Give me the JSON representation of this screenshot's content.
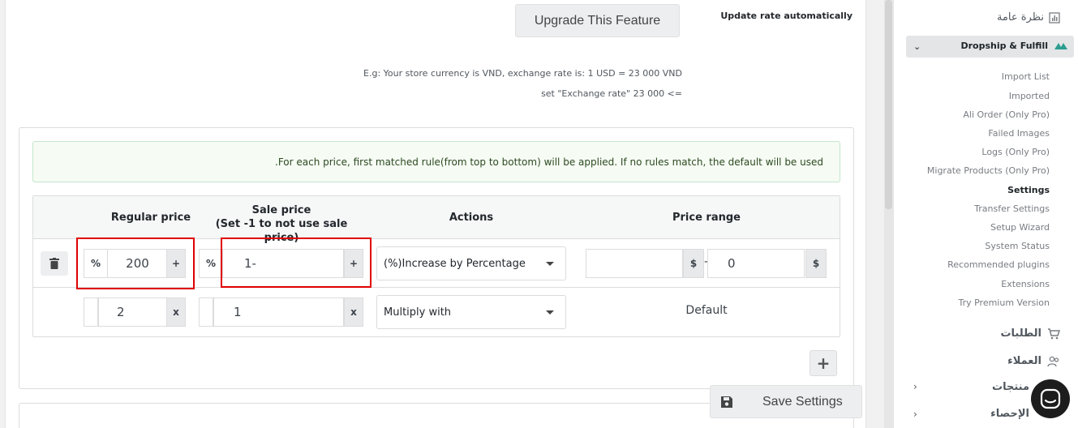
{
  "header": {
    "upgrade_label": "Upgrade This Feature",
    "update_rate_label": "Update rate automatically",
    "hint_line1": "E.g: Your store currency is VND, exchange rate is: 1 USD = 23 000 VND",
    "hint_line2": "set \"Exchange rate\" 23 000 <="
  },
  "rules": {
    "notice": ".For each price, first matched rule(from top to bottom) will be applied. If no rules match, the default will be used",
    "columns": {
      "regular": "Regular price",
      "sale_line1": "Sale price",
      "sale_line2": "(Set -1 to not use sale price)",
      "actions": "Actions",
      "range": "Price range"
    },
    "row1": {
      "regular_unit": "%",
      "regular_value": "200",
      "regular_addon": "+",
      "sale_unit": "%",
      "sale_value": "1-",
      "sale_addon": "+",
      "action": "(%)Increase by Percentage",
      "range_from": "",
      "range_from_unit": "$",
      "range_sep": "-",
      "range_to": "0",
      "range_to_unit": "$"
    },
    "row2": {
      "regular_value": "2",
      "regular_addon": "x",
      "sale_value": "1",
      "sale_addon": "x",
      "action": "Multiply with",
      "range_label": "Default"
    },
    "add_label": "+"
  },
  "footer": {
    "save_label": "Save Settings"
  },
  "sidebar": {
    "overview": "نظرة عامة",
    "active_section": "Dropship & Fulfill",
    "subitems": [
      "Import List",
      "Imported",
      "Ali Order (Only Pro)",
      "Failed Images",
      "Logs (Only Pro)",
      "Migrate Products (Only Pro)",
      "Settings",
      "Transfer Settings",
      "Setup Wizard",
      "System Status",
      "Recommended plugins",
      "Extensions",
      "Try Premium Version"
    ],
    "current_subitem": "Settings",
    "menus": [
      "الطلبات",
      "العملاء",
      "منتجات",
      "الإحصاء"
    ]
  },
  "colors": {
    "highlight": "#e00000",
    "notice_border": "#c3e6cb",
    "chat_bg": "#1d1d1d"
  }
}
